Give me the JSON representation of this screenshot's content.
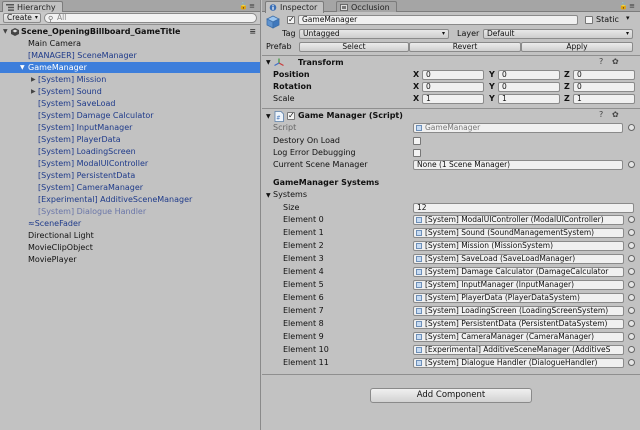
{
  "hierarchy": {
    "tab_label": "Hierarchy",
    "create_label": "Create",
    "search_placeholder": "All",
    "scene_name": "Scene_OpeningBillboard_GameTitle",
    "items": [
      {
        "label": "Main Camera"
      },
      {
        "label": "[MANAGER] SceneManager"
      },
      {
        "label": "GameManager"
      },
      {
        "label": "[System] Mission"
      },
      {
        "label": "[System] Sound"
      },
      {
        "label": "[System] SaveLoad"
      },
      {
        "label": "[System] Damage Calculator"
      },
      {
        "label": "[System] InputManager"
      },
      {
        "label": "[System] PlayerData"
      },
      {
        "label": "[System] LoadingScreen"
      },
      {
        "label": "[System] ModalUIController"
      },
      {
        "label": "[System] PersistentData"
      },
      {
        "label": "[System] CameraManager"
      },
      {
        "label": "[Experimental] AdditiveSceneManager"
      },
      {
        "label": "[System] Dialogue Handler"
      },
      {
        "label": "≈SceneFader"
      },
      {
        "label": "Directional Light"
      },
      {
        "label": "MovieClipObject"
      },
      {
        "label": "MoviePlayer"
      }
    ]
  },
  "inspector": {
    "tab_label": "Inspector",
    "occlusion_tab_label": "Occlusion",
    "object_name": "GameManager",
    "static_label": "Static",
    "tag_label": "Tag",
    "tag_value": "Untagged",
    "layer_label": "Layer",
    "layer_value": "Default",
    "prefab_label": "Prefab",
    "prefab_select": "Select",
    "prefab_revert": "Revert",
    "prefab_apply": "Apply",
    "transform": {
      "title": "Transform",
      "position_label": "Position",
      "rotation_label": "Rotation",
      "scale_label": "Scale",
      "position": {
        "x": "0",
        "y": "0",
        "z": "0"
      },
      "rotation": {
        "x": "0",
        "y": "0",
        "z": "0"
      },
      "scale": {
        "x": "1",
        "y": "1",
        "z": "1"
      },
      "axis_x": "X",
      "axis_y": "Y",
      "axis_z": "Z"
    },
    "script_component": {
      "title": "Game Manager (Script)",
      "script_label": "Script",
      "script_value": "GameManager",
      "destroy_label": "Destory On Load",
      "log_label": "Log Error Debugging",
      "current_scene_label": "Current Scene Manager",
      "current_scene_value": "None (1 Scene Manager)",
      "systems_header": "GameManager Systems",
      "systems_label": "Systems",
      "size_label": "Size",
      "size_value": "12",
      "elements": [
        {
          "label": "Element 0",
          "value": "[System] ModalUIController (ModalUIController)"
        },
        {
          "label": "Element 1",
          "value": "[System] Sound (SoundManagementSystem)"
        },
        {
          "label": "Element 2",
          "value": "[System] Mission (MissionSystem)"
        },
        {
          "label": "Element 3",
          "value": "[System] SaveLoad (SaveLoadManager)"
        },
        {
          "label": "Element 4",
          "value": "[System] Damage Calculator (DamageCalculator"
        },
        {
          "label": "Element 5",
          "value": "[System] InputManager (InputManager)"
        },
        {
          "label": "Element 6",
          "value": "[System] PlayerData (PlayerDataSystem)"
        },
        {
          "label": "Element 7",
          "value": "[System] LoadingScreen (LoadingScreenSystem)"
        },
        {
          "label": "Element 8",
          "value": "[System] PersistentData (PersistentDataSystem)"
        },
        {
          "label": "Element 9",
          "value": "[System] CameraManager (CameraManager)"
        },
        {
          "label": "Element 10",
          "value": "[Experimental] AdditiveSceneManager (AdditiveS"
        },
        {
          "label": "Element 11",
          "value": "[System] Dialogue Handler (DialogueHandler)"
        }
      ]
    },
    "add_component_label": "Add Component"
  }
}
